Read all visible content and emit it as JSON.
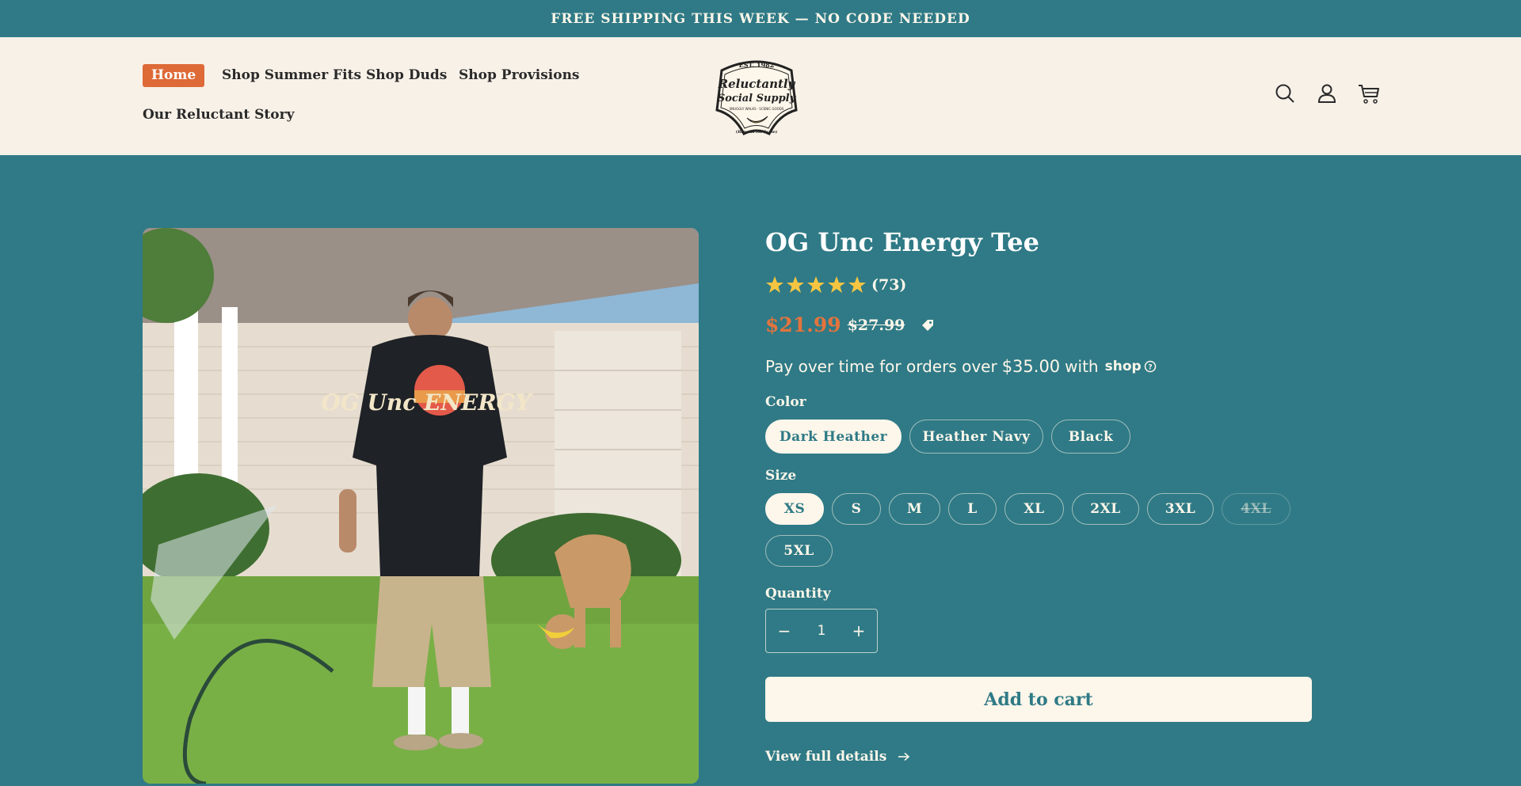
{
  "announcement": "FREE SHIPPING THIS WEEK — NO CODE NEEDED",
  "nav": {
    "home": "Home",
    "summer": "Shop Summer Fits",
    "duds": "Shop Duds",
    "provisions": "Shop Provisions",
    "story": "Our Reluctant Story"
  },
  "logo": {
    "est": "EST. 1982",
    "line1": "Reluctantly",
    "line2": "Social Supply",
    "tagline": "SNUGGLY WALKS · SCENIC GOODS",
    "bottom": "(Banana for Scale)"
  },
  "header_icons": [
    "search-icon",
    "account-icon",
    "cart-icon"
  ],
  "product": {
    "title": "OG Unc Energy Tee",
    "rating": 5,
    "rating_count": "(73)",
    "price": "$21.99",
    "compare_price": "$27.99",
    "installments": {
      "prefix": "Pay over time for orders over",
      "amount": "$35.00",
      "suffix": "with",
      "provider": "shop"
    },
    "color_label": "Color",
    "colors": [
      "Dark Heather",
      "Heather Navy",
      "Black"
    ],
    "selected_color": "Dark Heather",
    "size_label": "Size",
    "sizes": [
      "XS",
      "S",
      "M",
      "L",
      "XL",
      "2XL",
      "3XL",
      "4XL",
      "5XL"
    ],
    "selected_size": "XS",
    "unavailable_sizes": [
      "4XL"
    ],
    "quantity_label": "Quantity",
    "quantity": "1",
    "qty_minus": "−",
    "qty_plus": "+",
    "add_to_cart": "Add to cart",
    "view_details": "View full details",
    "shirt_print": "OG Unc ENERGY"
  },
  "colors": {
    "background": "#2f7a86",
    "header_bg": "#f8f1e8",
    "accent": "#dd6a37",
    "cream": "#fdf6ea",
    "star": "#f5c542"
  }
}
